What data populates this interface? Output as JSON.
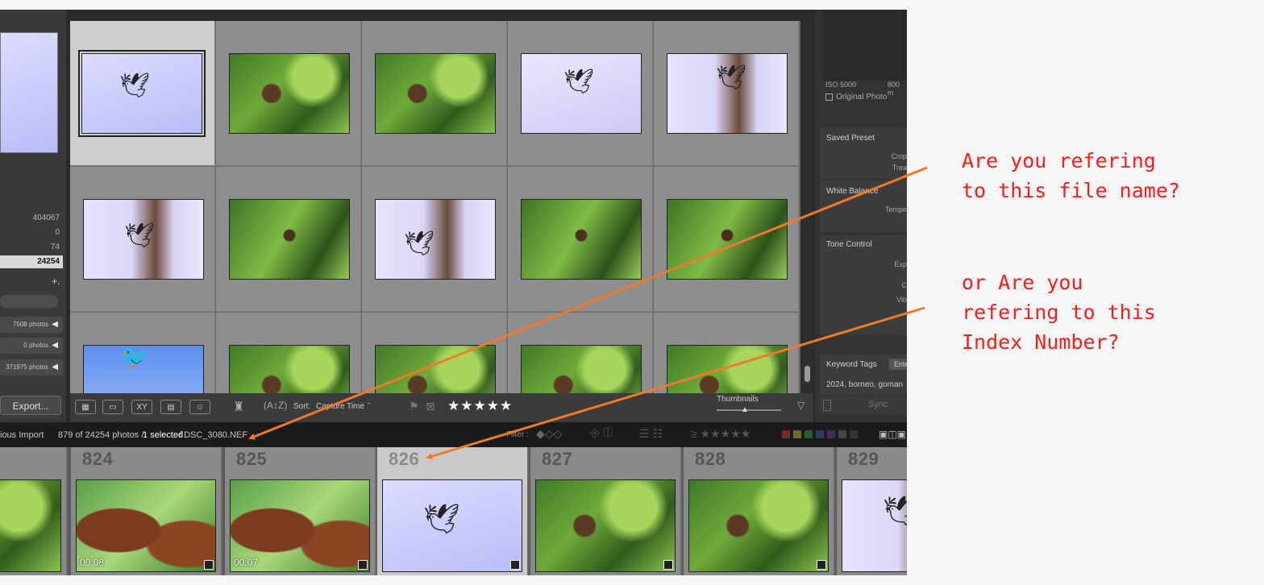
{
  "left_panel": {
    "counts": [
      "404067",
      "0",
      "74",
      "24254"
    ],
    "plus_label": "+.",
    "collections": [
      {
        "count": "7508 photos"
      },
      {
        "count": "0 photos"
      },
      {
        "count": "371975 photos"
      }
    ],
    "export_label": "Export..."
  },
  "grid": {
    "rows": [
      [
        "sky-bird",
        "jungle-orangutan",
        "jungle-orangutan",
        "sky-bird-2",
        "sky-bird-trunk"
      ],
      [
        "trunk-bird",
        "jungle-orangutan-2",
        "trunk-bird-2",
        "jungle",
        "jungle"
      ],
      [
        "blue-sky-bird",
        "jungle",
        "jungle",
        "jungle",
        "jungle"
      ]
    ]
  },
  "toolbar": {
    "sort_label": "Sort:",
    "sort_value": "Capture Time",
    "rating": "★★★★★",
    "thumbnails_label": "Thumbnails"
  },
  "right_panel": {
    "iso": "ISO 5000",
    "focal": "800 m",
    "original_photo": "Original Photo",
    "saved_preset": "Saved Preset",
    "crop": "Crop",
    "treat": "Trea",
    "white_balance": "White Balance",
    "temp": "Tempe",
    "tone_control": "Tone Control",
    "exp": "Exp",
    "c": "C",
    "vib": "Vib",
    "keyword_tags": "Keyword Tags",
    "enter": "Ente",
    "keywords_value": "2024, borneo, goman",
    "sync": "Sync"
  },
  "status_bar": {
    "source": "ious Import",
    "count": "879 of 24254 photos /",
    "selected": "1 selected",
    "filename": "/ DSC_3080.NEF",
    "filter_label": "Filter :",
    "rating_filter": "≥ ★★★★★"
  },
  "filmstrip": [
    {
      "index": "",
      "kind": "jungle",
      "duration": ""
    },
    {
      "index": "824",
      "kind": "orangutan",
      "duration": "00:08"
    },
    {
      "index": "825",
      "kind": "orangutan",
      "duration": "00:07"
    },
    {
      "index": "826",
      "kind": "sky-bird",
      "duration": ""
    },
    {
      "index": "827",
      "kind": "jungle-orangutan",
      "duration": ""
    },
    {
      "index": "828",
      "kind": "jungle-orangutan",
      "duration": ""
    },
    {
      "index": "829",
      "kind": "sky-bird-2",
      "duration": ""
    }
  ],
  "annotations": {
    "filename_question": "Are you refering\nto this file name?",
    "index_question": "or Are you\nrefering to this\nIndex Number?"
  },
  "colors": {
    "annotation_text": "#ff1a1a",
    "arrow": "#f07a2a"
  }
}
